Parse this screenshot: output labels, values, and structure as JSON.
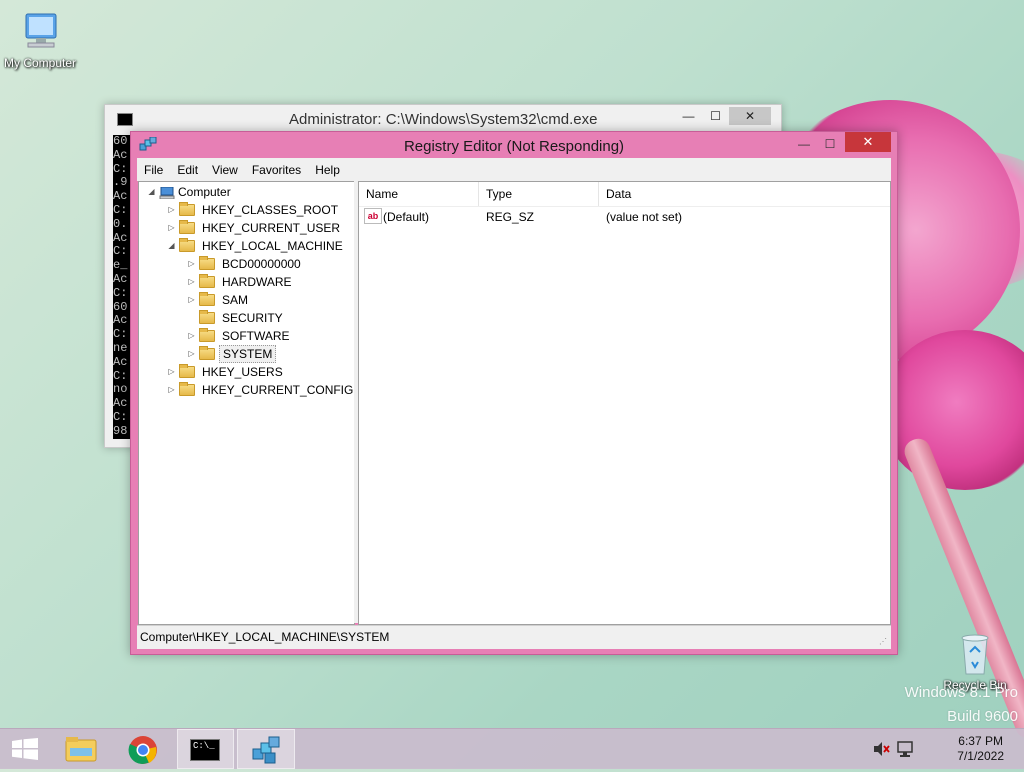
{
  "desktop": {
    "icons": [
      {
        "label": "My Computer",
        "icon": "computer-icon"
      },
      {
        "label": "Recycle Bin",
        "icon": "recycle-bin-icon"
      }
    ],
    "watermark_line1": "Windows 8.1 Pro",
    "watermark_line2": "Build 9600"
  },
  "cmd_window": {
    "title": "Administrator: C:\\Windows\\System32\\cmd.exe",
    "console_lines": [
      "60",
      "Ac",
      "C:",
      ".9",
      "Ac",
      "C:",
      "0.",
      "Ac",
      "C:",
      "e_",
      "Ac",
      "C:",
      "60",
      "Ac",
      "C:",
      "ne",
      "Ac",
      "C:",
      "no",
      "Ac",
      "C:",
      "98",
      "Ac",
      "",
      "C:"
    ],
    "buttons": {
      "minimize": "—",
      "maximize": "☐",
      "close": "✕"
    }
  },
  "regedit": {
    "title": "Registry Editor (Not Responding)",
    "buttons": {
      "minimize": "—",
      "maximize": "☐",
      "close": "✕"
    },
    "menu": [
      "File",
      "Edit",
      "View",
      "Favorites",
      "Help"
    ],
    "tree": [
      {
        "label": "Computer",
        "expander": "◢",
        "icon": "computer-icon"
      },
      {
        "label": "HKEY_CLASSES_ROOT",
        "expander": "▷"
      },
      {
        "label": "HKEY_CURRENT_USER",
        "expander": "▷"
      },
      {
        "label": "HKEY_LOCAL_MACHINE",
        "expander": "◢"
      },
      {
        "label": "BCD00000000",
        "expander": "▷"
      },
      {
        "label": "HARDWARE",
        "expander": "▷"
      },
      {
        "label": "SAM",
        "expander": "▷"
      },
      {
        "label": "SECURITY",
        "expander": ""
      },
      {
        "label": "SOFTWARE",
        "expander": "▷"
      },
      {
        "label": "SYSTEM",
        "expander": "▷",
        "selected": true
      },
      {
        "label": "HKEY_USERS",
        "expander": "▷"
      },
      {
        "label": "HKEY_CURRENT_CONFIG",
        "expander": "▷"
      }
    ],
    "list": {
      "columns": [
        "Name",
        "Type",
        "Data"
      ],
      "rows": [
        {
          "name": "(Default)",
          "type": "REG_SZ",
          "data": "(value not set)",
          "icon": "string-value-icon"
        }
      ]
    },
    "status": "Computer\\HKEY_LOCAL_MACHINE\\SYSTEM"
  },
  "taskbar": {
    "items": [
      {
        "name": "start-button",
        "icon": "windows-logo-icon"
      },
      {
        "name": "file-explorer",
        "icon": "folder-icon"
      },
      {
        "name": "chrome",
        "icon": "chrome-icon"
      },
      {
        "name": "command-prompt",
        "icon": "cmd-icon"
      },
      {
        "name": "registry-editor",
        "icon": "regedit-icon"
      }
    ],
    "tray_icons": [
      "volume-muted-icon",
      "network-icon"
    ],
    "time": "6:37 PM",
    "date": "7/1/2022"
  }
}
